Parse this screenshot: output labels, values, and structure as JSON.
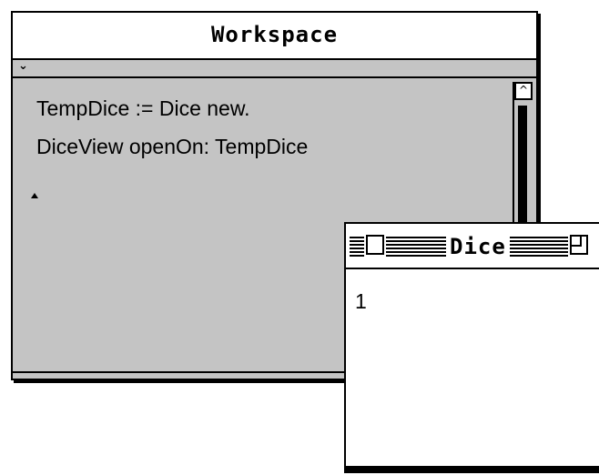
{
  "workspace": {
    "title": "Workspace",
    "menu_icon": "chevron-down-icon",
    "code_lines": [
      "TempDice := Dice new.",
      "DiceView openOn: TempDice"
    ],
    "scroll_up_icon": "scroll-up-arrow-icon"
  },
  "dice_window": {
    "title": "Dice",
    "value": "1"
  }
}
